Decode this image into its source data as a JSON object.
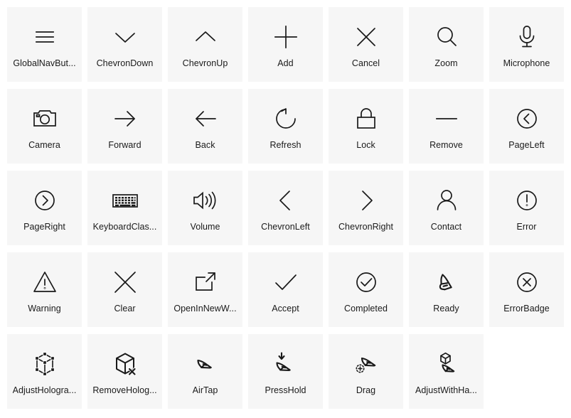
{
  "page": {
    "title": "Icon Gallery",
    "background_color": "#ffffff",
    "tile_color": "#f6f6f6",
    "glyph_color": "#1a1a1a",
    "label_color": "#1a1a1a",
    "columns": 7,
    "rows": 5
  },
  "icons": [
    {
      "name": "GlobalNavButton",
      "label": "GlobalNavBut...",
      "icon": "global-nav-button-icon"
    },
    {
      "name": "ChevronDown",
      "label": "ChevronDown",
      "icon": "chevron-down-icon"
    },
    {
      "name": "ChevronUp",
      "label": "ChevronUp",
      "icon": "chevron-up-icon"
    },
    {
      "name": "Add",
      "label": "Add",
      "icon": "add-icon"
    },
    {
      "name": "Cancel",
      "label": "Cancel",
      "icon": "cancel-icon"
    },
    {
      "name": "Zoom",
      "label": "Zoom",
      "icon": "zoom-icon"
    },
    {
      "name": "Microphone",
      "label": "Microphone",
      "icon": "microphone-icon"
    },
    {
      "name": "Camera",
      "label": "Camera",
      "icon": "camera-icon"
    },
    {
      "name": "Forward",
      "label": "Forward",
      "icon": "forward-arrow-icon"
    },
    {
      "name": "Back",
      "label": "Back",
      "icon": "back-arrow-icon"
    },
    {
      "name": "Refresh",
      "label": "Refresh",
      "icon": "refresh-icon"
    },
    {
      "name": "Lock",
      "label": "Lock",
      "icon": "lock-icon"
    },
    {
      "name": "Remove",
      "label": "Remove",
      "icon": "remove-icon"
    },
    {
      "name": "PageLeft",
      "label": "PageLeft",
      "icon": "page-left-icon"
    },
    {
      "name": "PageRight",
      "label": "PageRight",
      "icon": "page-right-icon"
    },
    {
      "name": "KeyboardClassic",
      "label": "KeyboardClas...",
      "icon": "keyboard-classic-icon"
    },
    {
      "name": "Volume",
      "label": "Volume",
      "icon": "volume-icon"
    },
    {
      "name": "ChevronLeft",
      "label": "ChevronLeft",
      "icon": "chevron-left-icon"
    },
    {
      "name": "ChevronRight",
      "label": "ChevronRight",
      "icon": "chevron-right-icon"
    },
    {
      "name": "Contact",
      "label": "Contact",
      "icon": "contact-icon"
    },
    {
      "name": "Error",
      "label": "Error",
      "icon": "error-icon"
    },
    {
      "name": "Warning",
      "label": "Warning",
      "icon": "warning-icon"
    },
    {
      "name": "Clear",
      "label": "Clear",
      "icon": "clear-icon"
    },
    {
      "name": "OpenInNewWindow",
      "label": "OpenInNewW...",
      "icon": "open-in-new-window-icon"
    },
    {
      "name": "Accept",
      "label": "Accept",
      "icon": "accept-icon"
    },
    {
      "name": "Completed",
      "label": "Completed",
      "icon": "completed-icon"
    },
    {
      "name": "Ready",
      "label": "Ready",
      "icon": "ready-hand-icon"
    },
    {
      "name": "ErrorBadge",
      "label": "ErrorBadge",
      "icon": "error-badge-icon"
    },
    {
      "name": "AdjustHologram",
      "label": "AdjustHologra...",
      "icon": "adjust-hologram-icon"
    },
    {
      "name": "RemoveHologram",
      "label": "RemoveHolog...",
      "icon": "remove-hologram-icon"
    },
    {
      "name": "AirTap",
      "label": "AirTap",
      "icon": "air-tap-icon"
    },
    {
      "name": "PressHold",
      "label": "PressHold",
      "icon": "press-hold-icon"
    },
    {
      "name": "Drag",
      "label": "Drag",
      "icon": "drag-icon"
    },
    {
      "name": "AdjustWithHand",
      "label": "AdjustWithHa...",
      "icon": "adjust-with-hand-icon"
    }
  ]
}
